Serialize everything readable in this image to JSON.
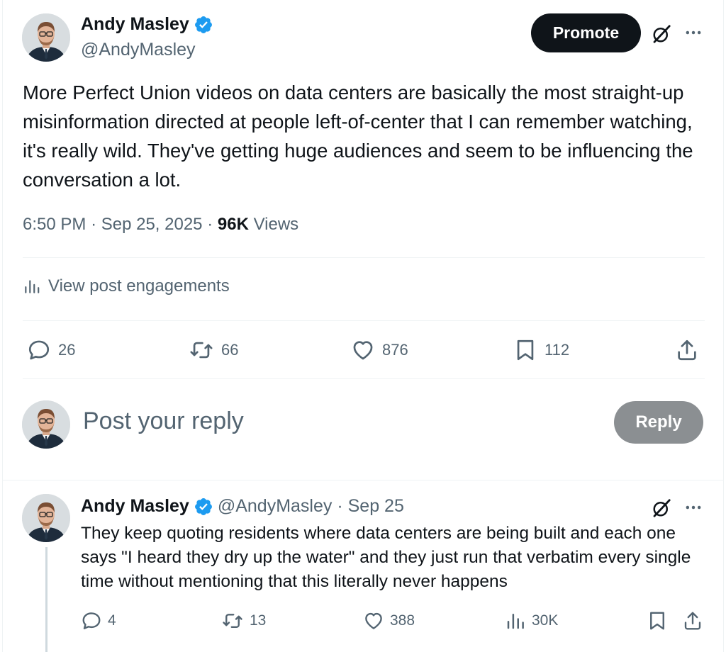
{
  "tweet": {
    "author": {
      "display_name": "Andy Masley",
      "handle": "@AndyMasley",
      "verified": true
    },
    "promote_label": "Promote",
    "text": "More Perfect Union videos on data centers are basically the most straight-up misinformation directed at people left-of-center that I can remember watching, it's really wild. They've getting huge audiences and seem to be influencing the conversation a lot.",
    "time": "6:50 PM",
    "date": "Sep 25, 2025",
    "views_count": "96K",
    "views_label": "Views",
    "engagements_label": "View post engagements",
    "stats": {
      "replies": "26",
      "reposts": "66",
      "likes": "876",
      "bookmarks": "112"
    }
  },
  "composer": {
    "placeholder": "Post your reply",
    "reply_label": "Reply"
  },
  "reply": {
    "author": {
      "display_name": "Andy Masley",
      "handle": "@AndyMasley",
      "verified": true
    },
    "date": "Sep 25",
    "text": "They keep quoting residents where data centers are being built and each one says \"I heard they dry up the water\" and they just run that verbatim every single time without mentioning that this literally never happens",
    "stats": {
      "replies": "4",
      "reposts": "13",
      "likes": "388",
      "views": "30K"
    }
  },
  "colors": {
    "text": "#0f1419",
    "secondary": "#536471",
    "verified_blue": "#1d9bf0",
    "divider": "#eff3f4",
    "reply_button_disabled": "#8b8f92"
  },
  "icons": [
    "verified-badge-icon",
    "grok-icon",
    "more-icon",
    "analytics-icon",
    "reply-icon",
    "repost-icon",
    "like-icon",
    "bookmark-icon",
    "share-icon"
  ]
}
